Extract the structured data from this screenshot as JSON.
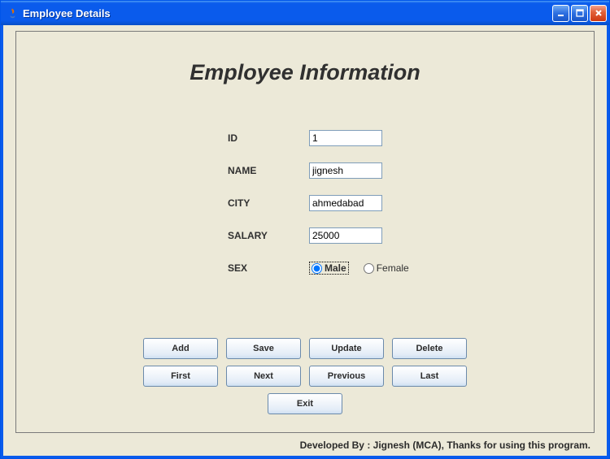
{
  "window": {
    "title": "Employee Details"
  },
  "heading": "Employee Information",
  "form": {
    "id_label": "ID",
    "id_value": "1",
    "name_label": "NAME",
    "name_value": "jignesh",
    "city_label": "CITY",
    "city_value": "ahmedabad",
    "salary_label": "SALARY",
    "salary_value": "25000",
    "sex_label": "SEX",
    "sex_options": {
      "male": "Male",
      "female": "Female"
    },
    "sex_selected": "male"
  },
  "buttons": {
    "add": "Add",
    "save": "Save",
    "update": "Update",
    "delete": "Delete",
    "first": "First",
    "next": "Next",
    "previous": "Previous",
    "last": "Last",
    "exit": "Exit"
  },
  "footer": "Developed By : Jignesh (MCA), Thanks for using this program."
}
